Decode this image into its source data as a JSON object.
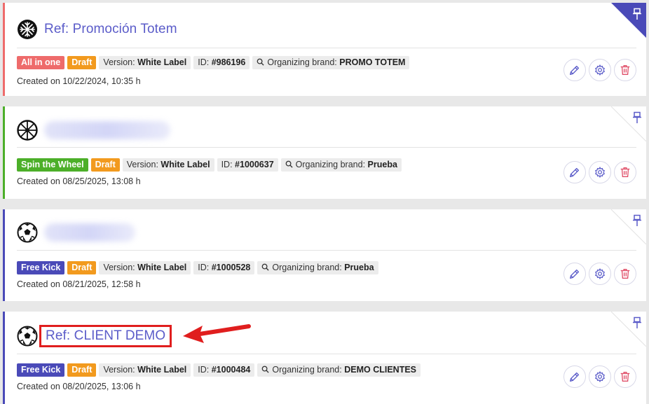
{
  "colors": {
    "title": "#5b5cc9",
    "draft": "#f29a1e",
    "all_in_one": "#ee6b6b",
    "spin_the_wheel": "#4caf29",
    "free_kick": "#4a4ab8",
    "highlight": "#e01e1e"
  },
  "campaigns": [
    {
      "accent": "#ee6b6b",
      "icon": "snowflake-icon",
      "title": "Ref: Promoción Totem",
      "title_blurred": false,
      "type_label": "All in one",
      "type_color": "#ee6b6b",
      "status": "Draft",
      "version_label": "Version:",
      "version_value": "White Label",
      "id_label": "ID:",
      "id_value": "#986196",
      "brand_label": "Organizing brand:",
      "brand_value": "PROMO TOTEM",
      "created": "Created on 10/22/2024, 10:35 h",
      "pinned": true
    },
    {
      "accent": "#4caf29",
      "icon": "wheel-icon",
      "title": "",
      "title_blurred": true,
      "type_label": "Spin the Wheel",
      "type_color": "#4caf29",
      "status": "Draft",
      "version_label": "Version:",
      "version_value": "White Label",
      "id_label": "ID:",
      "id_value": "#1000637",
      "brand_label": "Organizing brand:",
      "brand_value": "Prueba",
      "created": "Created on 08/25/2025, 13:08 h",
      "pinned": false
    },
    {
      "accent": "#4a4ab8",
      "icon": "soccer-ball-icon",
      "title": "",
      "title_blurred": true,
      "type_label": "Free Kick",
      "type_color": "#4a4ab8",
      "status": "Draft",
      "version_label": "Version:",
      "version_value": "White Label",
      "id_label": "ID:",
      "id_value": "#1000528",
      "brand_label": "Organizing brand:",
      "brand_value": "Prueba",
      "created": "Created on 08/21/2025, 12:58 h",
      "pinned": false
    },
    {
      "accent": "#4a4ab8",
      "icon": "soccer-ball-icon",
      "title": "Ref: CLIENT DEMO",
      "title_blurred": false,
      "type_label": "Free Kick",
      "type_color": "#4a4ab8",
      "status": "Draft",
      "version_label": "Version:",
      "version_value": "White Label",
      "id_label": "ID:",
      "id_value": "#1000484",
      "brand_label": "Organizing brand:",
      "brand_value": "DEMO CLIENTES",
      "created": "Created on 08/20/2025, 13:06 h",
      "pinned": false
    }
  ]
}
